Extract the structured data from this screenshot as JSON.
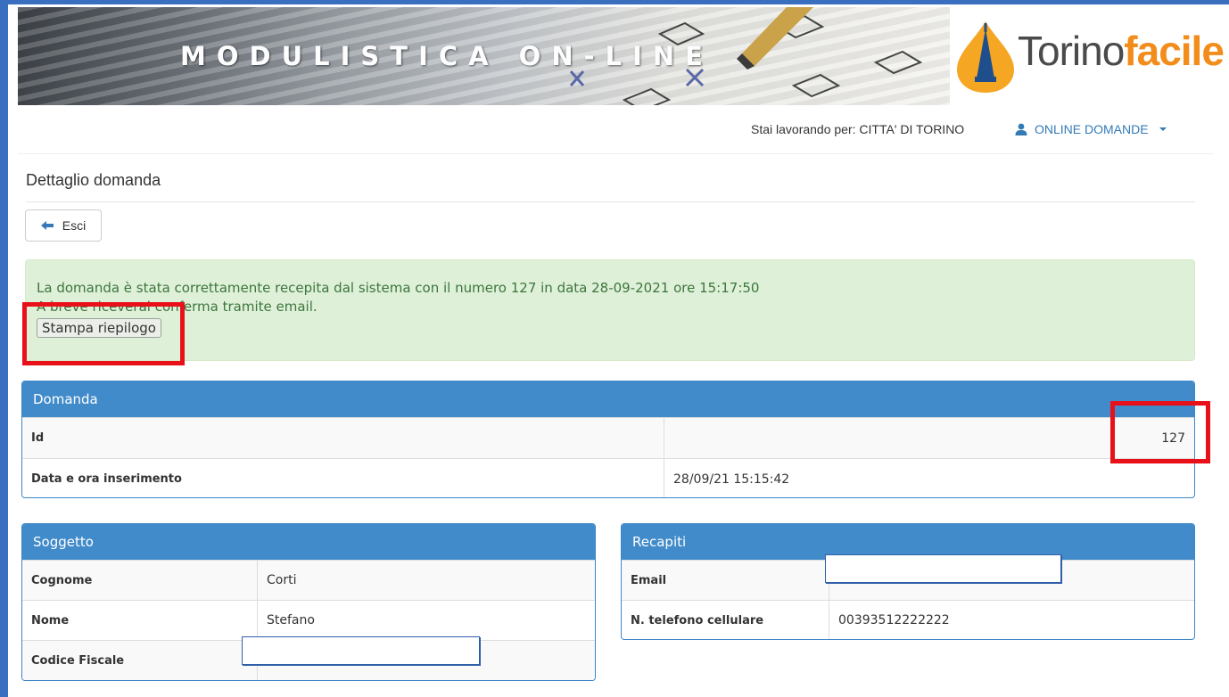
{
  "banner": {
    "title": "MODULISTICA ON-LINE",
    "logo_part1": "Torino",
    "logo_part2": "facile"
  },
  "topnav": {
    "working_for": "Stai lavorando per: CITTA' DI TORINO",
    "user_menu": "ONLINE DOMANDE"
  },
  "page": {
    "title": "Dettaglio domanda",
    "exit_button": "Esci"
  },
  "alert": {
    "line1": "La domanda è stata correttamente recepita dal sistema con il numero 127 in data 28-09-2021 ore 15:17:50",
    "line2": "A breve riceverai conferma tramite email.",
    "print_button": "Stampa riepilogo"
  },
  "domanda": {
    "header": "Domanda",
    "rows": [
      {
        "label": "Id",
        "value": "127"
      },
      {
        "label": "Data e ora inserimento",
        "value": "28/09/21 15:15:42"
      }
    ]
  },
  "soggetto": {
    "header": "Soggetto",
    "rows": [
      {
        "label": "Cognome",
        "value": "Corti"
      },
      {
        "label": "Nome",
        "value": "Stefano"
      },
      {
        "label": "Codice Fiscale",
        "value": ""
      }
    ]
  },
  "recapiti": {
    "header": "Recapiti",
    "rows": [
      {
        "label": "Email",
        "value": ""
      },
      {
        "label": "N. telefono cellulare",
        "value": "00393512222222"
      }
    ]
  },
  "colors": {
    "frame": "#3a6fc0",
    "panel_header": "#428bca",
    "alert_bg": "#dff0d8",
    "alert_text": "#3c763d",
    "highlight": "#e8111a",
    "link": "#337ab7",
    "logo_orange": "#f28c1a"
  }
}
